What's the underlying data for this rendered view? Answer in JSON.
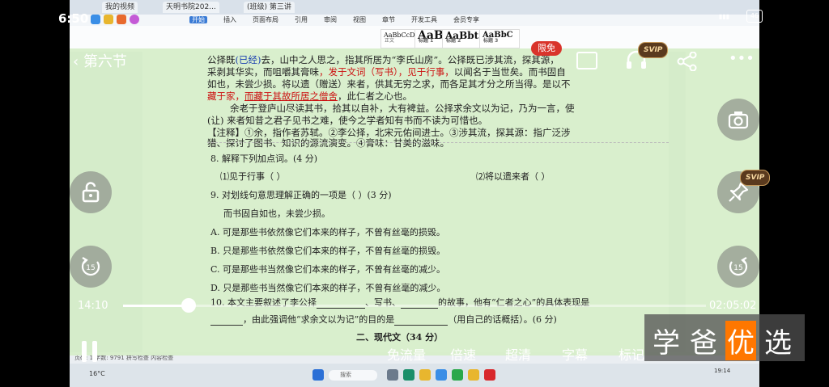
{
  "phone_status": {
    "time": "6:50",
    "battery": "46"
  },
  "header": {
    "back_label": "第六节",
    "free_badge": "限免",
    "svip_badge": "SVIP"
  },
  "recording": {
    "tabs": [
      "我的视频",
      "天明书院202...",
      "(班级) 第三讲"
    ],
    "menu": [
      "开始",
      "插入",
      "页面布局",
      "引用",
      "审阅",
      "视图",
      "章节",
      "开发工具",
      "会员专享"
    ],
    "styles": [
      "AaBbCcDt",
      "AaBl",
      "AaBbt",
      "AaBbC"
    ],
    "style_labels": [
      "正文",
      "标题 1",
      "标题 2",
      "标题 3"
    ],
    "status_text": "页码: 1  字数: 9791  拼写检查  内容检查",
    "weather": "16°C",
    "taskbar_search": "搜索",
    "clock": "19:14"
  },
  "document": {
    "passage": {
      "line1a": "公择既",
      "line1b": "(已经)",
      "line1c": "去，山中之人思之，指其所居为“李氏山房”。公择既已涉其流，探其源，",
      "line2a": "采剥其华实，而咀嚼其膏味",
      "line2b": "，发于文词（写书），见于行事，",
      "line2c": "以闻名于当世矣。而书固自",
      "line3": "如也，未尝少损。将以遗（赠送）来者，供其无穷之求，而各足其才分之所当得。是以不",
      "line4a": "藏于家，",
      "line4b": "而藏于其故所居之僧舍",
      "line4c": "，此仁者之心也。",
      "line5": "余老于登庐山尽读其书，拾其以自补，大有裨益。公择求余文以为记，乃为一言，使",
      "line6": "(让) 来者知昔之君子见书之难，使今之学者知有书而不读为可惜也。",
      "note1": "【注释】①余，指作者苏轼。②李公择，北宋元佑间进士。③涉其流，探其源：指广泛涉",
      "note2": "猎、探讨了图书、知识的源流演变。④膏味：甘美的滋味。"
    },
    "q8": "8. 解释下列加点词。(4 分)",
    "q8_a": "⑴见于行事（                ）",
    "q8_b": "⑵将以遗来者（              ）",
    "q9": "9. 对划线句意思理解正确的一项是（      ）(3 分)",
    "q9_sentence": "而书固自如也，未尝少损。",
    "options": [
      "A. 可是那些书依然像它们本来的样子，不曾有丝毫的损毁。",
      "B. 只是那些书依然像它们本来的样子，不曾有丝毫的损毁。",
      "C. 可是那些书当然像它们本来的样子，不曾有丝毫的减少。",
      "D. 只是那些书当然像它们本来的样子，不曾有丝毫的减少。"
    ],
    "q10a": "10. 本文主要叙述了李公择",
    "q10b": "、写书、",
    "q10c": "的故事，他有“仁者之心”的具体表现是",
    "q10d": "，由此强调他“求余文以为记”的目的是",
    "q10e": "（用自己的话概括）。(6 分)",
    "section2": "二、现代文（34 分）"
  },
  "player": {
    "current_time": "14:10",
    "total_time": "02:05:02",
    "progress": 0.113,
    "controls": [
      "免流量",
      "倍速",
      "超清",
      "字幕",
      "标记"
    ],
    "skip_seconds": "15"
  },
  "watermark": {
    "chars": [
      "学",
      "爸",
      "优",
      "选"
    ]
  },
  "colors": {
    "accent": "#ffffff",
    "doc_bg": "#d6eec9",
    "highlight_red": "#cc1111",
    "watermark_box": "#ff7700"
  }
}
